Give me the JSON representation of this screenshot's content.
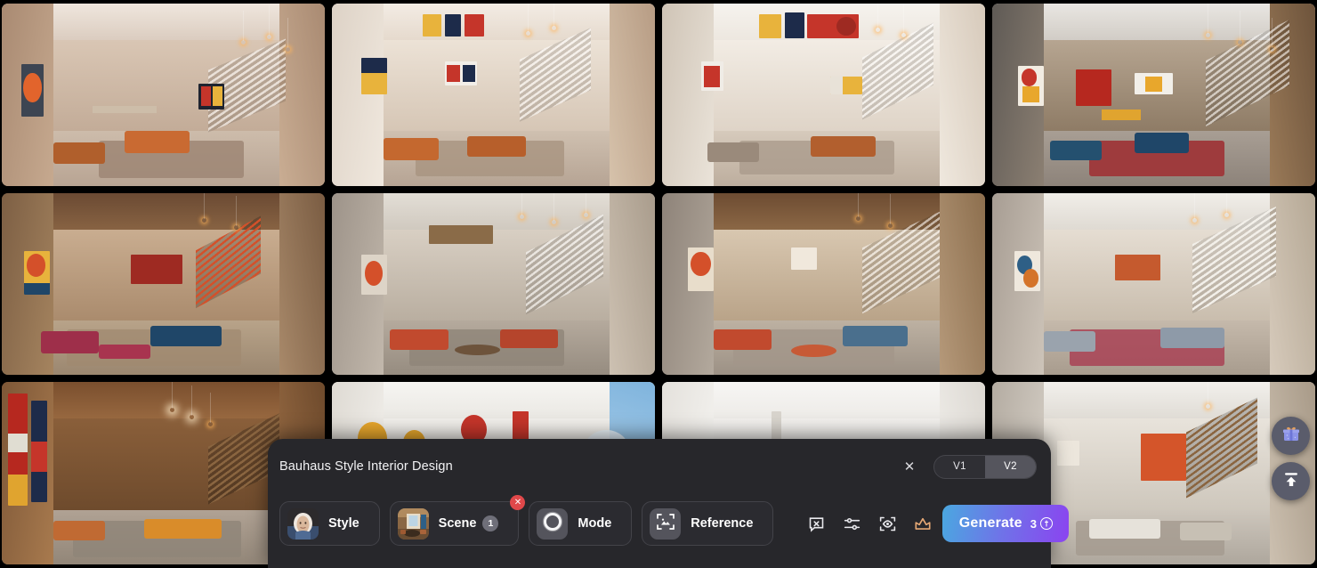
{
  "panel": {
    "prompt_title": "Bauhaus Style Interior Design",
    "close_label": "✕",
    "version_toggle": {
      "options": [
        {
          "label": "V1",
          "active": false
        },
        {
          "label": "V2",
          "active": true
        }
      ]
    },
    "chips": [
      {
        "name": "style",
        "label": "Style",
        "count": null,
        "removable": false
      },
      {
        "name": "scene",
        "label": "Scene",
        "count": "1",
        "removable": true,
        "remove_label": "✕"
      },
      {
        "name": "mode",
        "label": "Mode",
        "count": null,
        "removable": false
      },
      {
        "name": "reference",
        "label": "Reference",
        "count": null,
        "removable": false
      }
    ],
    "tool_icons": [
      {
        "name": "no-prompt-bubble-icon"
      },
      {
        "name": "settings-sliders-icon"
      },
      {
        "name": "focus-eye-icon"
      },
      {
        "name": "crown-premium-icon"
      }
    ],
    "generate": {
      "label": "Generate",
      "cost": "3",
      "cost_icon": "credit-coin-icon"
    }
  },
  "side_buttons": [
    {
      "name": "gift-rewards-button",
      "icon": "gift-icon"
    },
    {
      "name": "scroll-to-top-button",
      "icon": "arrow-up-to-line-icon"
    }
  ],
  "gallery": {
    "count": 12,
    "items": [
      {
        "id": 1,
        "alt": "Bauhaus loft living room, warm taupe plaster walls, tan leather sofas, orange and grey abstract art, concrete stairs"
      },
      {
        "id": 2,
        "alt": "Double-height Bauhaus interior, white walls, primary-colour block canvases, cognac leather sofas, wooden stair"
      },
      {
        "id": 3,
        "alt": "Bright white Bauhaus living space, red and blue geometric mural, brown leather seating, grey rug"
      },
      {
        "id": 4,
        "alt": "Dark wood Bauhaus loft, red accent wall, yellow kitchen cabinets, navy sofa, deep red rug, floating stair"
      },
      {
        "id": 5,
        "alt": "Warm-lit Bauhaus lounge, red staircase, crimson and teal sofas, circular orange artwork, rattan ceiling"
      },
      {
        "id": 6,
        "alt": "Concrete Bauhaus interior, orange oval canvas, red sofa, round wood coffee table, pale stair"
      },
      {
        "id": 7,
        "alt": "Bauhaus apartment, orange abstract art, red sofa and ottoman, blue sectional, timber ceiling, open kitchen"
      },
      {
        "id": 8,
        "alt": "Light Bauhaus living area, blue and orange circle art, grey sofa, magenta rug, white floating stair"
      },
      {
        "id": 9,
        "alt": "Walnut-panelled Bauhaus loft, tall red and yellow tapestry, amber sofa, cluster pendant lights"
      },
      {
        "id": 10,
        "alt": "Minimal white Bauhaus room, orange and red wall shapes, blue sky window, pale floor"
      },
      {
        "id": 11,
        "alt": "Soft white Bauhaus interior, pale walls, minimal furniture, diffuse daylight"
      },
      {
        "id": 12,
        "alt": "Bauhaus great room, orange accent wall, white sofa, wooden stair, concrete floor"
      }
    ]
  },
  "colors": {
    "panel_bg": "#27272b",
    "chip_bg": "#2b2b30",
    "chip_border": "#434349",
    "accent_crown": "#e6a875",
    "badge_red": "#e0484a",
    "generate_gradient_from": "#4aa8e0",
    "generate_gradient_to": "#8b43f0",
    "side_button_bg": "#5a5c6b",
    "gift_icon": "#8b93e8",
    "gift_bow": "#e3a05f"
  }
}
